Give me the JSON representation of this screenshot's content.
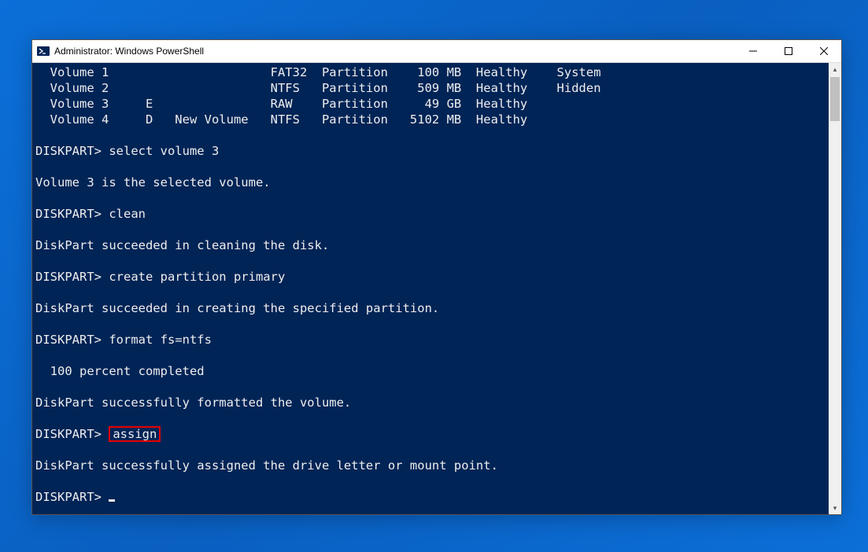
{
  "window": {
    "title": "Administrator: Windows PowerShell"
  },
  "terminal": {
    "volumes": [
      {
        "line": "  Volume 1                      FAT32  Partition    100 MB  Healthy    System"
      },
      {
        "line": "  Volume 2                      NTFS   Partition    509 MB  Healthy    Hidden"
      },
      {
        "line": "  Volume 3     E                RAW    Partition     49 GB  Healthy"
      },
      {
        "line": "  Volume 4     D   New Volume   NTFS   Partition   5102 MB  Healthy"
      }
    ],
    "block1_prompt": "DISKPART> ",
    "block1_cmd": "select volume 3",
    "block1_resp": "Volume 3 is the selected volume.",
    "block2_prompt": "DISKPART> ",
    "block2_cmd": "clean",
    "block2_resp": "DiskPart succeeded in cleaning the disk.",
    "block3_prompt": "DISKPART> ",
    "block3_cmd": "create partition primary",
    "block3_resp": "DiskPart succeeded in creating the specified partition.",
    "block4_prompt": "DISKPART> ",
    "block4_cmd": "format fs=ntfs",
    "block4_progress": "  100 percent completed",
    "block4_resp": "DiskPart successfully formatted the volume.",
    "block5_prompt": "DISKPART> ",
    "block5_cmd": "assign",
    "block5_resp": "DiskPart successfully assigned the drive letter or mount point.",
    "block6_prompt": "DISKPART> "
  }
}
